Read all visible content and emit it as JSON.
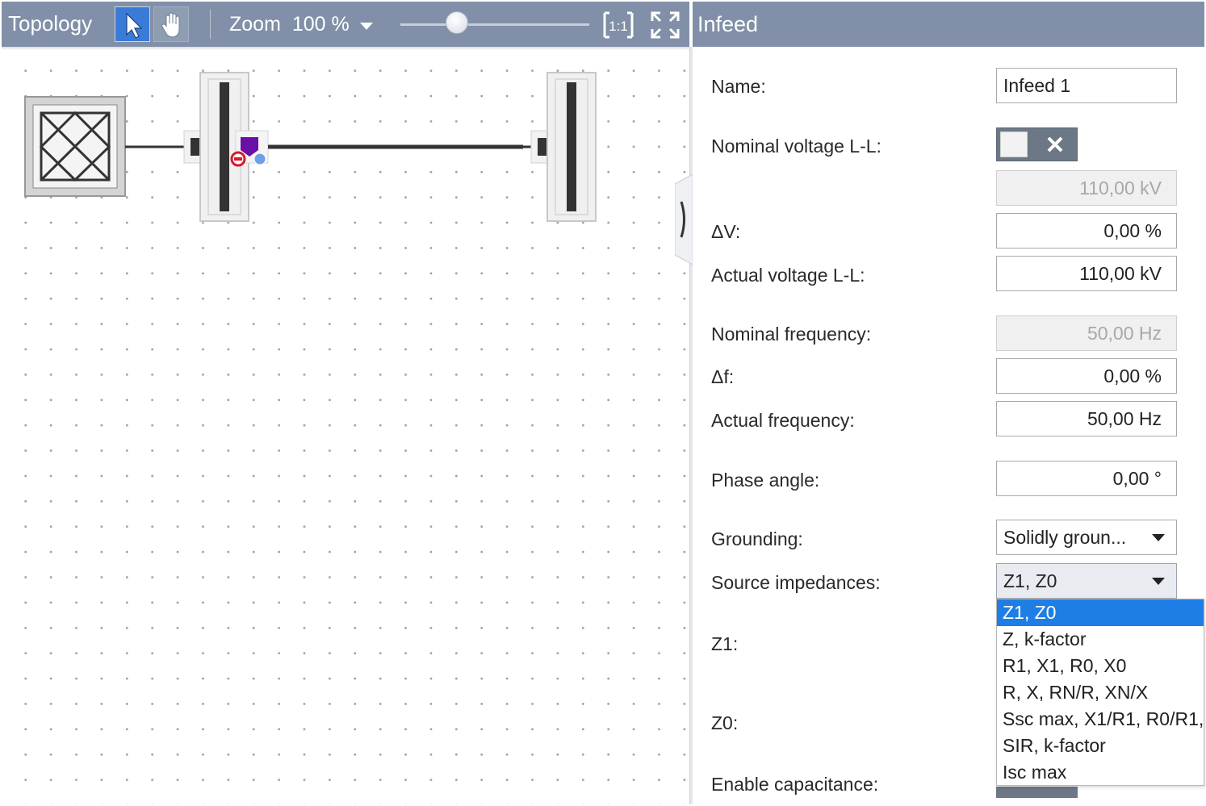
{
  "topology": {
    "title": "Topology",
    "zoom_label": "Zoom",
    "zoom_value": "100 %",
    "zoom_slider_level": 0.3
  },
  "properties": {
    "title": "Infeed",
    "name_label": "Name:",
    "name_value": "Infeed 1",
    "nominal_voltage_label": "Nominal voltage L-L:",
    "nominal_voltage_value": "110,00 kV",
    "nominal_voltage_enabled": false,
    "delta_v_label": "ΔV:",
    "delta_v_value": "0,00 %",
    "actual_voltage_label": "Actual voltage L-L:",
    "actual_voltage_value": "110,00 kV",
    "nominal_frequency_label": "Nominal frequency:",
    "nominal_frequency_value": "50,00 Hz",
    "delta_f_label": "Δf:",
    "delta_f_value": "0,00 %",
    "actual_frequency_label": "Actual frequency:",
    "actual_frequency_value": "50,00 Hz",
    "phase_angle_label": "Phase angle:",
    "phase_angle_value": "0,00 °",
    "grounding_label": "Grounding:",
    "grounding_value": "Solidly groun...",
    "source_impedances_label": "Source impedances:",
    "source_impedances_value": "Z1, Z0",
    "z1_label": "Z1:",
    "z0_label": "Z0:",
    "enable_capacitance_label": "Enable capacitance:"
  },
  "source_impedance_options": [
    "Z1, Z0",
    "Z, k-factor",
    "R1, X1, R0, X0",
    "R, X, RN/R, XN/X",
    "Ssc max, X1/R1, R0/R1,",
    "SIR, k-factor",
    "Isc max"
  ],
  "selected_option_index": 0,
  "colors": {
    "header_bg": "#8190a8",
    "selection_blue": "#1e7ee6",
    "tool_active": "#3b7bd8",
    "busbar": "#333333",
    "infeed_purple": "#6a0fa8"
  }
}
